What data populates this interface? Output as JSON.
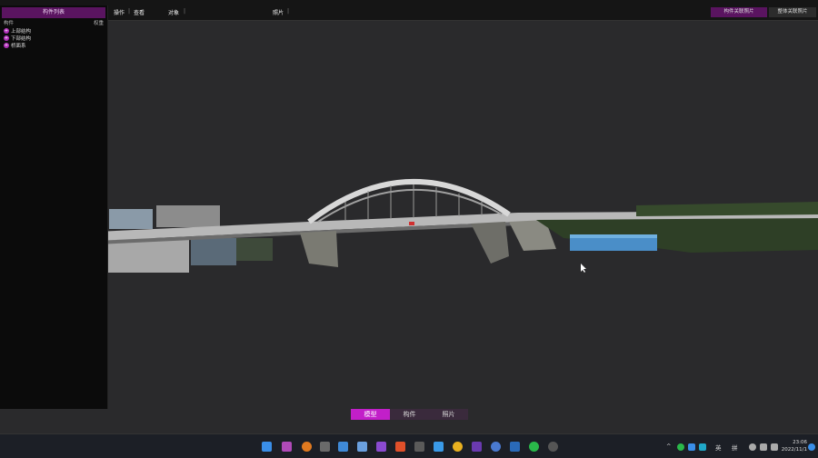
{
  "sidebar": {
    "title": "构件列表",
    "col_left": "构件",
    "col_right": "权重",
    "items": [
      {
        "label": "上部结构"
      },
      {
        "label": "下部结构"
      },
      {
        "label": "桥面系"
      }
    ]
  },
  "menu": {
    "operate": "操作",
    "view": "查看",
    "object": "对象",
    "photo": "照片"
  },
  "top_tabs": {
    "component_photos": "构件关联照片",
    "all_photos": "整体关联照片"
  },
  "bottom_tabs": [
    {
      "label": "模型",
      "active": true
    },
    {
      "label": "构件",
      "active": false
    },
    {
      "label": "照片",
      "active": false
    }
  ],
  "tray": {
    "lang1": "英",
    "lang2": "拼",
    "time": "23:06",
    "date": "2022/11/1"
  },
  "colors": {
    "accent": "#c21fc9",
    "sidebar_header": "#5a1460",
    "background": "#2a2a2c"
  }
}
